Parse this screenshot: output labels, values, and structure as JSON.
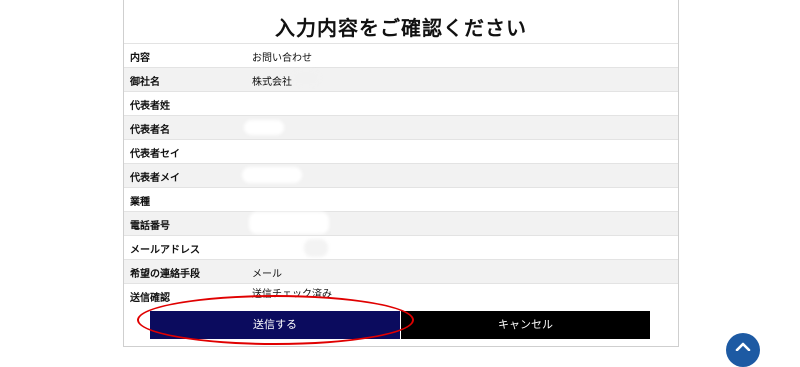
{
  "page": {
    "title": "入力内容をご確認ください"
  },
  "form_rows": [
    {
      "label": "内容",
      "value": "お問い合わせ"
    },
    {
      "label": "御社名",
      "value": "株式会社"
    },
    {
      "label": "代表者姓",
      "value": ""
    },
    {
      "label": "代表者名",
      "value": ""
    },
    {
      "label": "代表者セイ",
      "value": ""
    },
    {
      "label": "代表者メイ",
      "value": ""
    },
    {
      "label": "業種",
      "value": ""
    },
    {
      "label": "電話番号",
      "value": ""
    },
    {
      "label": "メールアドレス",
      "value": ""
    },
    {
      "label": "希望の連絡手段",
      "value": "メール"
    },
    {
      "label": "送信確認",
      "value": "送信チェック済み"
    }
  ],
  "buttons": {
    "send_label": "送信する",
    "cancel_label": "キャンセル"
  },
  "colors": {
    "send_button": "#0b0b5e",
    "cancel_button": "#000000",
    "highlight": "#e00000",
    "scroll_top": "#1d5aa3"
  },
  "icons": {
    "scroll_top": "chevron-up-icon"
  }
}
